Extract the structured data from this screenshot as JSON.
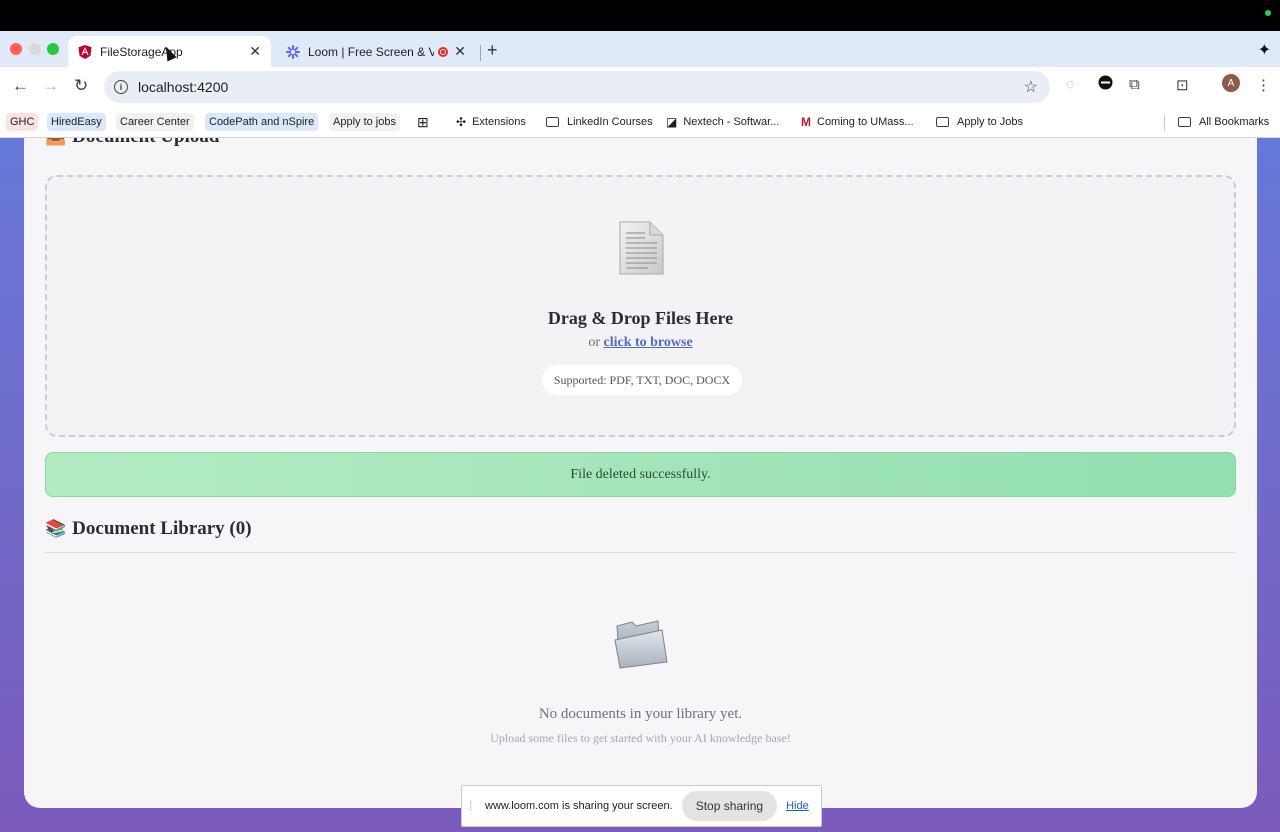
{
  "browser": {
    "tabs": [
      {
        "title": "FileStorageApp",
        "active": true
      },
      {
        "title": "Loom | Free Screen & Video Recording",
        "active": false
      }
    ],
    "url": "localhost:4200",
    "avatar_letter": "A",
    "bookmarks": [
      {
        "label": "GHC",
        "bg": "#fde2e2"
      },
      {
        "label": "HiredEasy",
        "bg": "#dbe7fb"
      },
      {
        "label": "Career Center",
        "bg": "#f1f1f1"
      },
      {
        "label": "CodePath and nSpire",
        "bg": "#dbe7fb"
      },
      {
        "label": "Apply to jobs",
        "bg": "#f1f1f1"
      },
      {
        "label": "Extensions"
      },
      {
        "label": "LinkedIn Courses"
      },
      {
        "label": "Nextech - Softwar..."
      },
      {
        "label": "Coming to UMass..."
      },
      {
        "label": "Apply to Jobs"
      },
      {
        "label": "All Bookmarks"
      }
    ]
  },
  "upload": {
    "section_title": "Document Upload",
    "dropzone_title": "Drag & Drop Files Here",
    "browse_prefix": "or",
    "browse_link": "click to browse",
    "supported": "Supported: PDF, TXT, DOC, DOCX"
  },
  "alert": {
    "message": "File deleted successfully."
  },
  "library": {
    "section_title": "Document Library (0)",
    "empty_title": "No documents in your library yet.",
    "empty_subtitle": "Upload some files to get started with your AI knowledge base!"
  },
  "sharebar": {
    "message": "www.loom.com is sharing your screen.",
    "stop_label": "Stop sharing",
    "hide_label": "Hide"
  },
  "colors": {
    "page_gradient_top": "#6678d8",
    "page_gradient_bottom": "#7b5bbb",
    "success_bg": "#a7e7bb",
    "link": "#5569c9"
  }
}
